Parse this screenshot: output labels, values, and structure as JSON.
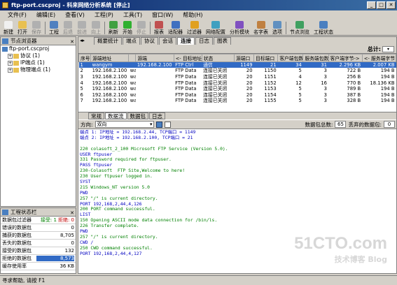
{
  "window": {
    "title": "ftp-port.cscproj - 科来网络分析系统 [停止]",
    "minimize": "_",
    "maximize": "□",
    "close": "✕"
  },
  "menu": [
    "文件(F)",
    "编辑(E)",
    "查看(V)",
    "工程(P)",
    "工具(T)",
    "窗口(W)",
    "帮助(H)"
  ],
  "toolbar": [
    {
      "label": "新建",
      "color": "#f0f0f0",
      "disabled": false
    },
    {
      "label": "打开",
      "color": "#e8c050",
      "disabled": false
    },
    {
      "label": "保存",
      "color": "#b0b0b0",
      "disabled": true
    },
    {
      "label": "工程",
      "color": "#5080c0",
      "disabled": false
    },
    {
      "label": "后退",
      "color": "#b0b0b0",
      "disabled": true
    },
    {
      "label": "前进",
      "color": "#b0b0b0",
      "disabled": true
    },
    {
      "label": "向上",
      "color": "#b0b0b0",
      "disabled": true
    },
    {
      "label": "刷新",
      "color": "#40a040",
      "disabled": false
    },
    {
      "label": "开始",
      "color": "#30b030",
      "disabled": false
    },
    {
      "label": "停止",
      "color": "#b0b0b0",
      "disabled": true
    },
    {
      "label": "报表",
      "color": "#c05050",
      "disabled": false
    },
    {
      "label": "适配器",
      "color": "#4070c0",
      "disabled": false
    },
    {
      "label": "过滤器",
      "color": "#e0a020",
      "disabled": false
    },
    {
      "label": "网络配置",
      "color": "#40a0c0",
      "disabled": false
    },
    {
      "label": "分析模块",
      "color": "#8050c0",
      "disabled": false
    },
    {
      "label": "名字表",
      "color": "#c08040",
      "disabled": false
    },
    {
      "label": "选项",
      "color": "#6090c0",
      "disabled": false
    },
    {
      "label": "节点浏览",
      "color": "#40a060",
      "disabled": false
    },
    {
      "label": "工程状态",
      "color": "#4a7fc0",
      "disabled": false
    }
  ],
  "node_browser": {
    "title": "节点浏览器",
    "items": [
      {
        "label": "ftp-port.cscproj",
        "level": 0,
        "expander": ""
      },
      {
        "label": "协议 (1)",
        "level": 1,
        "expander": "+"
      },
      {
        "label": "IP端点 (1)",
        "level": 1,
        "expander": "+"
      },
      {
        "label": "物理端点 (1)",
        "level": 1,
        "expander": "+"
      }
    ]
  },
  "project_status": {
    "title": "工程状态栏",
    "rows": [
      {
        "label": "数据包过滤器",
        "value": "",
        "accept": "接受: 1",
        "reject": "拒绝: 0"
      },
      {
        "label": "错误的数据包",
        "value": "0"
      },
      {
        "label": "捕获的数据包",
        "value": "8,705"
      },
      {
        "label": "丢失的数据包",
        "value": "0"
      },
      {
        "label": "接受的数据包",
        "value": "132"
      },
      {
        "label": "拒绝的数据包",
        "value": "8,573",
        "bar": 0.98
      },
      {
        "label": "缓存使用率",
        "value": "36 KB"
      }
    ]
  },
  "tabs": [
    "概要统计",
    "端点",
    "协议",
    "会话",
    "连接",
    "日志",
    "图表"
  ],
  "active_tab": "连接",
  "filter_bar": {
    "title": "总计:"
  },
  "table": {
    "columns": [
      "序号",
      "源端地址",
      "源端",
      "<- 目标地址",
      "状态",
      "源端口",
      "目标端口",
      "客户端包数",
      "服务端包数",
      "客户端字节->",
      "<- 服务端字节"
    ],
    "rows": [
      [
        "1",
        "wangym",
        "",
        "192.168.2.100",
        "FTP Ctrl",
        "通信",
        "1149",
        "21",
        "34",
        "31",
        "2.296 KB",
        "2.007 KB"
      ],
      [
        "2",
        "192.168.2.100",
        "wangym",
        "",
        "FTP Data",
        "连接已关闭",
        "20",
        "1150",
        "5",
        "3",
        "722 B",
        "194 B"
      ],
      [
        "3",
        "192.168.2.100",
        "wangym",
        "",
        "FTP Data",
        "连接已关闭",
        "20",
        "1151",
        "4",
        "3",
        "256 B",
        "194 B"
      ],
      [
        "4",
        "192.168.2.100",
        "wangym",
        "",
        "FTP Data",
        "连接已关闭",
        "20",
        "1152",
        "12",
        "16",
        "770 B",
        "18.136 KB"
      ],
      [
        "5",
        "192.168.2.100",
        "wangym",
        "",
        "FTP Data",
        "连接已关闭",
        "20",
        "1153",
        "5",
        "3",
        "789 B",
        "194 B"
      ],
      [
        "6",
        "192.168.2.100",
        "wangym",
        "",
        "FTP Data",
        "连接已关闭",
        "20",
        "1154",
        "5",
        "3",
        "387 B",
        "194 B"
      ],
      [
        "7",
        "192.168.2.100",
        "wangym",
        "",
        "FTP Data",
        "连接已关闭",
        "20",
        "1155",
        "5",
        "3",
        "328 B",
        "194 B"
      ]
    ]
  },
  "subtabs": [
    "常规",
    "数据流",
    "数据包",
    "日志"
  ],
  "active_subtab": "数据流",
  "direction": {
    "label": "方向:",
    "value": "双向",
    "packet_count_label": "数据包总数:",
    "packet_count": "65",
    "lost_label": "丢弃的数据包:",
    "lost_count": "0"
  },
  "stream_lines": [
    {
      "text": "端点 1: IP地址 = 192.168.2.44, TCP端口 = 1149",
      "color": "#0000c0"
    },
    {
      "text": "端点 2: IP地址 = 192.168.2.100, TCP端口 = 21",
      "color": "#0000c0"
    },
    {
      "text": "",
      "color": "#000"
    },
    {
      "text": "220 colasoft_2_100 Microsoft FTP Service (Version 5.0).",
      "color": "#008000"
    },
    {
      "text": "USER ftpuser",
      "color": "#0000c0"
    },
    {
      "text": "331 Password required for ftpuser.",
      "color": "#008000"
    },
    {
      "text": "PASS ftpuser",
      "color": "#0000c0"
    },
    {
      "text": "230-Colasoft  FTP Site,Welcome to here!",
      "color": "#008000"
    },
    {
      "text": "230 User ftpuser logged in.",
      "color": "#008000"
    },
    {
      "text": "SYST",
      "color": "#0000c0"
    },
    {
      "text": "215 Windows_NT version 5.0",
      "color": "#008000"
    },
    {
      "text": "PWD",
      "color": "#0000c0"
    },
    {
      "text": "257 \"/\" is current directory.",
      "color": "#008000"
    },
    {
      "text": "PORT 192,168,2,44,4,126",
      "color": "#0000c0"
    },
    {
      "text": "200 PORT command successful.",
      "color": "#008000"
    },
    {
      "text": "LIST",
      "color": "#0000c0"
    },
    {
      "text": "150 Opening ASCII mode data connection for /bin/ls.",
      "color": "#008000"
    },
    {
      "text": "226 Transfer complete.",
      "color": "#008000"
    },
    {
      "text": "PWD",
      "color": "#0000c0"
    },
    {
      "text": "257 \"/\" is current directory.",
      "color": "#008000"
    },
    {
      "text": "CWD /",
      "color": "#0000c0"
    },
    {
      "text": "250 CWD command successful.",
      "color": "#008000"
    },
    {
      "text": "PORT 192,168,2,44,4,127",
      "color": "#0000c0"
    }
  ],
  "statusbar": {
    "text": "寻求帮助, 请按 F1"
  },
  "watermark": {
    "main": "51CTO.com",
    "sub": "技术博客  Blog"
  }
}
